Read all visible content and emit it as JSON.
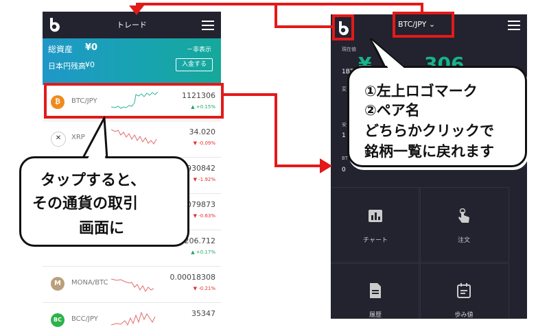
{
  "left_app": {
    "title": "トレード",
    "assets": {
      "total_label": "総資産",
      "total_value": "¥0",
      "hide_label": "－非表示",
      "jpy_label": "日本円残高",
      "jpy_value": "¥0",
      "deposit_label": "入金する"
    },
    "rows": [
      {
        "pair": "BTC/JPY",
        "price": "1121306",
        "change": "▲ +0.15%",
        "coin_color": "#f08a1c",
        "coin_text": "₿"
      },
      {
        "pair": "XRP",
        "price": "34.020",
        "change": "▼ -0.09%",
        "coin_color": "#ffffff",
        "coin_text": "✕"
      },
      {
        "pair": "",
        "price": "0930842",
        "change": "▼ -1.92%",
        "coin_color": "#ffffff",
        "coin_text": ""
      },
      {
        "pair": "",
        "price": "079873",
        "change": "▼ -0.63%",
        "coin_color": "#ffffff",
        "coin_text": ""
      },
      {
        "pair": "",
        "price": "206.712",
        "change": "▲ +0.17%",
        "coin_color": "#ffffff",
        "coin_text": ""
      },
      {
        "pair": "MONA/BTC",
        "price": "0.00018308",
        "change": "▼ -0.21%",
        "coin_color": "#b9a07a",
        "coin_text": "M"
      },
      {
        "pair": "BCC/JPY",
        "price": "35347",
        "change": "",
        "coin_color": "#2db34a",
        "coin_text": "BC"
      }
    ]
  },
  "right_app": {
    "pair_selector": "BTC/JPY",
    "current_price_label": "現在値",
    "unit_label": "1BT",
    "price_fragment_left": "¥",
    "price_fragment_right": "306",
    "side_labels": [
      "変",
      "安",
      "1",
      "BT",
      "0"
    ],
    "grid": [
      {
        "label": "チャート",
        "icon": "bar-chart-icon"
      },
      {
        "label": "注文",
        "icon": "tap-hand-icon"
      },
      {
        "label": "履歴",
        "icon": "document-icon"
      },
      {
        "label": "歩み値",
        "icon": "calendar-icon"
      }
    ]
  },
  "callouts": {
    "right": [
      "①左上ロゴマーク",
      "②ペア名",
      "どちらかクリックで",
      "銘柄一覧に戻れます"
    ],
    "left": [
      "タップすると、",
      "その通貨の取引",
      "画面に"
    ]
  },
  "colors": {
    "accent_red": "#e21a1a",
    "dark_bg": "#22232f",
    "green": "#17b38a",
    "up": "#1aa66a",
    "down": "#e03030"
  }
}
